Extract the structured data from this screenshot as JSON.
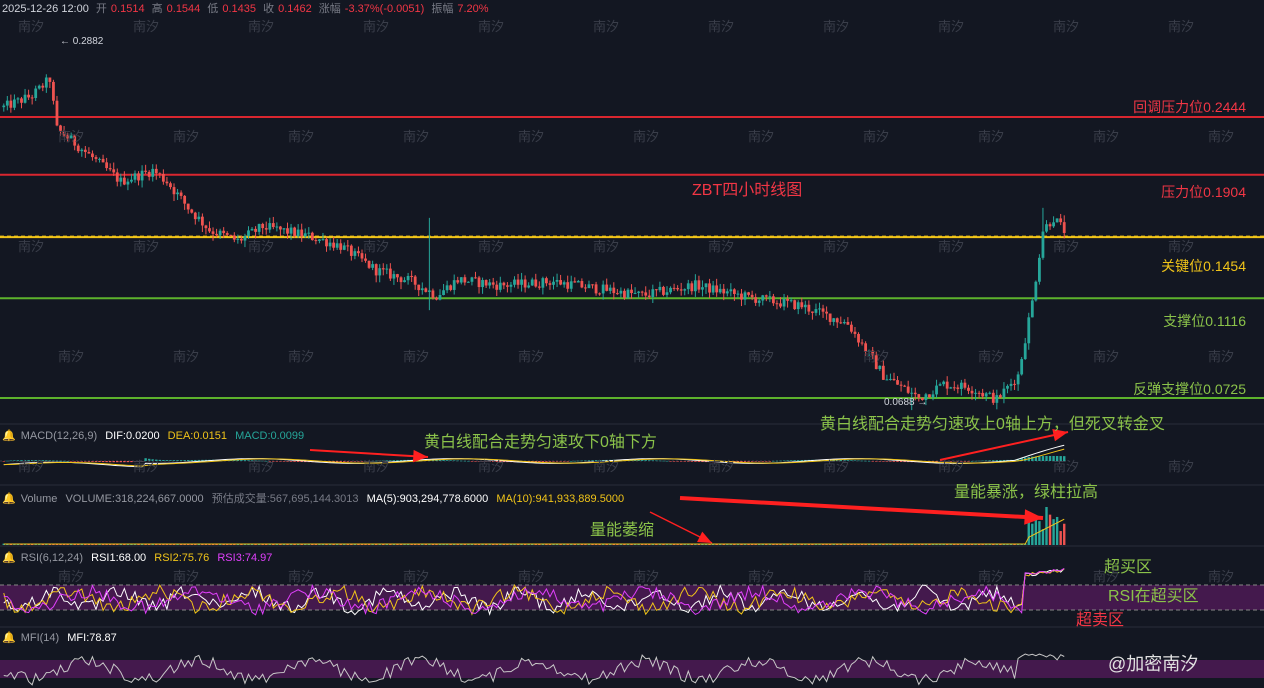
{
  "ohlc_bar": {
    "date": "2025-12-26 12:00",
    "open_label": "开",
    "open": "0.1514",
    "high_label": "高",
    "high": "0.1544",
    "low_label": "低",
    "low": "0.1435",
    "close_label": "收",
    "close": "0.1462",
    "change_label": "涨幅",
    "change": "-3.37%(-0.0051)",
    "amplitude_label": "振幅",
    "amplitude": "7.20%"
  },
  "watermark": "南汐",
  "footer_watermark": "@加密南汐",
  "colors": {
    "up": "#26a69a",
    "down": "#ef5350",
    "red_line": "#d9262f",
    "yellow_line": "#f0c419",
    "green_line": "#5db32c",
    "annotation": "#8bc34a",
    "arrow": "#ff2020"
  },
  "chart_data": [
    {
      "type": "candlestick",
      "title": "ZBT四小时线图",
      "y_scale": "log",
      "ylim": [
        0.066,
        0.3
      ],
      "price_labels": {
        "high": "0.2882",
        "low": "0.0688"
      },
      "levels": [
        {
          "label": "回调压力位0.2444",
          "value": 0.2444,
          "color": "#d9262f"
        },
        {
          "label": "压力位0.1904",
          "value": 0.1904,
          "color": "#d9262f"
        },
        {
          "label": "关键位0.1454",
          "value": 0.1454,
          "color": "#f0c419"
        },
        {
          "label": "支撑位0.1116",
          "value": 0.1116,
          "color": "#5db32c"
        },
        {
          "label": "反弹支撑位0.0725",
          "value": 0.0725,
          "color": "#5db32c"
        }
      ],
      "trend_keypoints": [
        [
          0,
          0.255
        ],
        [
          8,
          0.268
        ],
        [
          13,
          0.288
        ],
        [
          15,
          0.232
        ],
        [
          18,
          0.224
        ],
        [
          25,
          0.205
        ],
        [
          33,
          0.185
        ],
        [
          42,
          0.194
        ],
        [
          46,
          0.185
        ],
        [
          52,
          0.165
        ],
        [
          58,
          0.15
        ],
        [
          66,
          0.143
        ],
        [
          73,
          0.152
        ],
        [
          80,
          0.149
        ],
        [
          86,
          0.146
        ],
        [
          95,
          0.14
        ],
        [
          105,
          0.126
        ],
        [
          115,
          0.12
        ],
        [
          122,
          0.113
        ],
        [
          128,
          0.121
        ],
        [
          140,
          0.118
        ],
        [
          155,
          0.12
        ],
        [
          165,
          0.117
        ],
        [
          180,
          0.113
        ],
        [
          195,
          0.118
        ],
        [
          210,
          0.112
        ],
        [
          225,
          0.108
        ],
        [
          238,
          0.1
        ],
        [
          248,
          0.08
        ],
        [
          258,
          0.0725
        ],
        [
          265,
          0.077
        ],
        [
          272,
          0.076
        ],
        [
          280,
          0.072
        ],
        [
          286,
          0.08
        ],
        [
          290,
          0.11
        ],
        [
          293,
          0.15
        ],
        [
          296,
          0.158
        ],
        [
          300,
          0.147
        ]
      ],
      "annotation": "黄白线配合走势匀速攻上0轴上方，但死叉转金叉"
    },
    {
      "type": "line",
      "name": "MACD",
      "params": "MACD(12,26,9)",
      "values": {
        "DIF": "DIF:0.0200",
        "DEA": "DEA:0.0151",
        "MACD": "MACD:0.0099"
      },
      "series": [
        {
          "name": "DIF",
          "color": "#ffffff"
        },
        {
          "name": "DEA",
          "color": "#f0c419"
        }
      ],
      "annotation": "黄白线配合走势匀速攻下0轴下方"
    },
    {
      "type": "bar",
      "name": "Volume",
      "values": {
        "volume": "VOLUME:318,224,667.0000",
        "predicted": "预估成交量:567,695,144.3013",
        "ma5": "MA(5):903,294,778.6000",
        "ma10": "MA(10):941,933,889.5000"
      },
      "annotations": {
        "shrink": "量能萎缩",
        "surge": "量能暴涨，绿柱拉高"
      }
    },
    {
      "type": "line",
      "name": "RSI",
      "params": "RSI(6,12,24)",
      "values": {
        "rsi1": "RSI1:68.00",
        "rsi2": "RSI2:75.76",
        "rsi3": "RSI3:74.97"
      },
      "zones": {
        "overbought": "超买区",
        "oversold": "超卖区",
        "note": "RSI在超买区"
      }
    },
    {
      "type": "line",
      "name": "MFI",
      "params": "MFI(14)",
      "values": {
        "mfi": "MFI:78.87"
      }
    }
  ]
}
